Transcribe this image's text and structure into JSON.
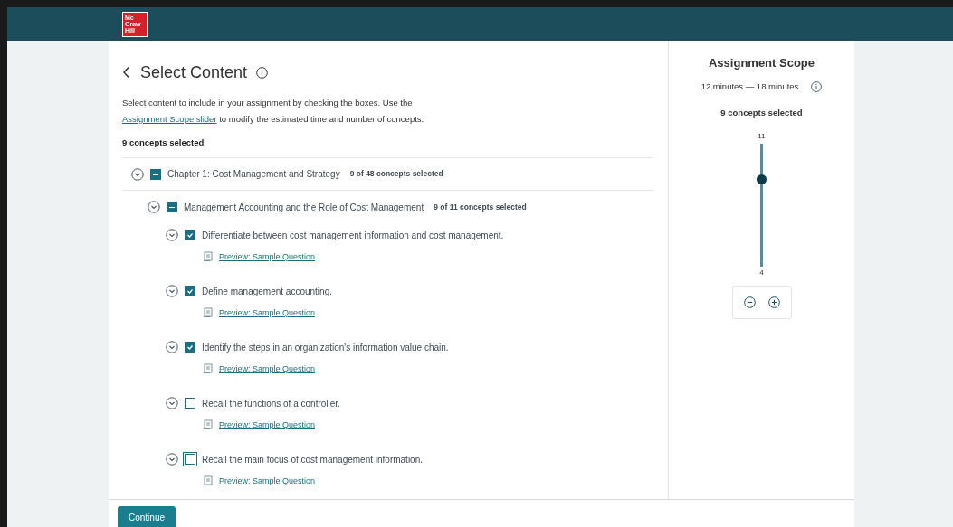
{
  "header": {
    "logo": [
      "Mc",
      "Graw",
      "Hill"
    ]
  },
  "main": {
    "title": "Select Content",
    "intro": "Select content to include in your assignment by checking the boxes. Use the",
    "intro_link": "Assignment Scope slider",
    "intro_rest": "to modify the estimated time and number of concepts.",
    "selected_count": "9 concepts selected",
    "tree": [
      {
        "label": "Chapter 1: Cost Management and Strategy",
        "count": "9 of 48 concepts selected",
        "indeterminate": true,
        "children": [
          {
            "label": "Management Accounting and the Role of Cost Management",
            "count": "9 of 11 concepts selected",
            "indeterminate": true,
            "children": [
              {
                "label": "Differentiate between cost management information and cost management.",
                "checked": true,
                "focused": false,
                "link": "Preview: Sample Question"
              },
              {
                "label": "Define management accounting.",
                "checked": true,
                "focused": false,
                "link": "Preview: Sample Question"
              },
              {
                "label": "Identify the steps in an organization's information value chain.",
                "checked": true,
                "focused": false,
                "link": "Preview: Sample Question"
              },
              {
                "label": "Recall the functions of a controller.",
                "checked": false,
                "focused": false,
                "link": "Preview: Sample Question"
              },
              {
                "label": "Recall the main focus of cost management information.",
                "checked": false,
                "focused": true,
                "link": "Preview: Sample Question"
              }
            ]
          }
        ]
      }
    ]
  },
  "scope": {
    "title": "Assignment Scope",
    "time": "12 minutes — 18 minutes",
    "selected": "9 concepts selected",
    "max": "11",
    "min": "4",
    "level": 0.71
  },
  "footer": {
    "button": "Continue"
  }
}
